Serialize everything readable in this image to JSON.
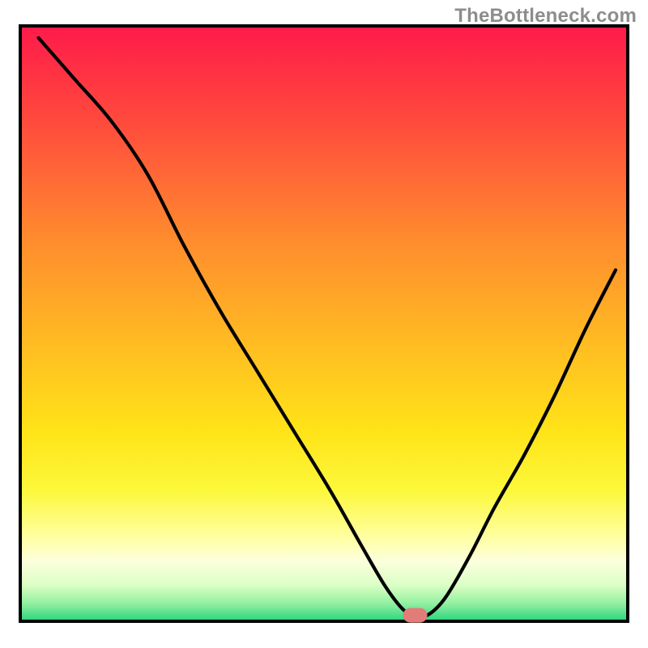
{
  "watermark": "TheBottleneck.com",
  "chart_data": {
    "type": "line",
    "title": "",
    "xlabel": "",
    "ylabel": "",
    "xlim": [
      0,
      100
    ],
    "ylim": [
      0,
      100
    ],
    "grid": false,
    "legend": false,
    "series": [
      {
        "name": "bottleneck-curve",
        "x": [
          3,
          9,
          15,
          21,
          27,
          33,
          39,
          45,
          51,
          56,
          60,
          63,
          65,
          67,
          70,
          74,
          78,
          83,
          88,
          93,
          98
        ],
        "values": [
          98,
          91,
          84,
          75,
          63,
          52,
          42,
          32,
          22,
          13,
          6,
          2,
          1,
          1,
          4,
          11,
          19,
          28,
          38,
          49,
          59
        ]
      }
    ],
    "marker": {
      "name": "optimal-range",
      "x_start": 63,
      "x_end": 67,
      "y": 1,
      "color": "#e27c78"
    },
    "background_gradient": {
      "stops": [
        {
          "pos": 0.0,
          "color": "#ff1a4a"
        },
        {
          "pos": 0.17,
          "color": "#ff4d3c"
        },
        {
          "pos": 0.36,
          "color": "#ff8c2e"
        },
        {
          "pos": 0.55,
          "color": "#ffc021"
        },
        {
          "pos": 0.68,
          "color": "#ffe318"
        },
        {
          "pos": 0.78,
          "color": "#fcf83a"
        },
        {
          "pos": 0.86,
          "color": "#ffffa4"
        },
        {
          "pos": 0.9,
          "color": "#fcffdd"
        },
        {
          "pos": 0.94,
          "color": "#daffc4"
        },
        {
          "pos": 0.97,
          "color": "#93f0a1"
        },
        {
          "pos": 1.0,
          "color": "#28d47d"
        }
      ]
    }
  }
}
